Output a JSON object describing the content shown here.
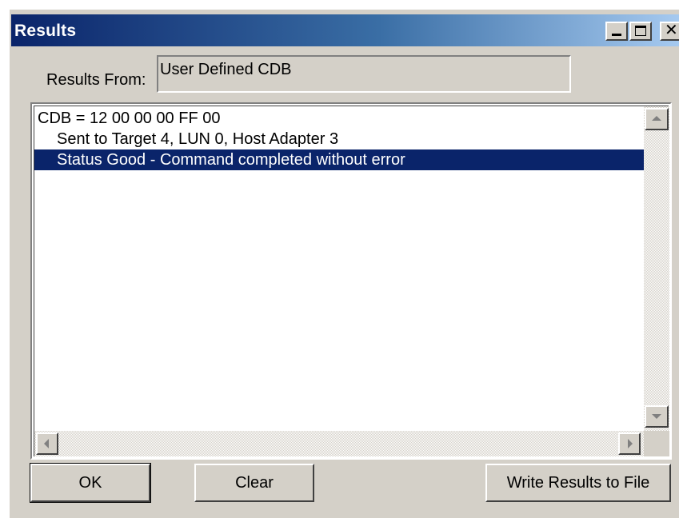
{
  "window": {
    "title": "Results",
    "title_gradient": [
      "#0a246a",
      "#a6caf0"
    ],
    "controls": [
      "minimize-icon",
      "maximize-icon",
      "close-icon"
    ]
  },
  "results_from": {
    "label": "Results From:",
    "value": "User Defined CDB"
  },
  "results_list": {
    "lines": [
      "CDB = 12 00 00 00 FF 00",
      "Sent to Target 4, LUN 0, Host Adapter 3",
      "Status Good - Command completed without error"
    ],
    "selected_index": 2,
    "selection_color": "#0a246a"
  },
  "buttons": {
    "ok": "OK",
    "clear": "Clear",
    "write": "Write Results to File"
  },
  "colors": {
    "face": "#d4d0c8"
  }
}
